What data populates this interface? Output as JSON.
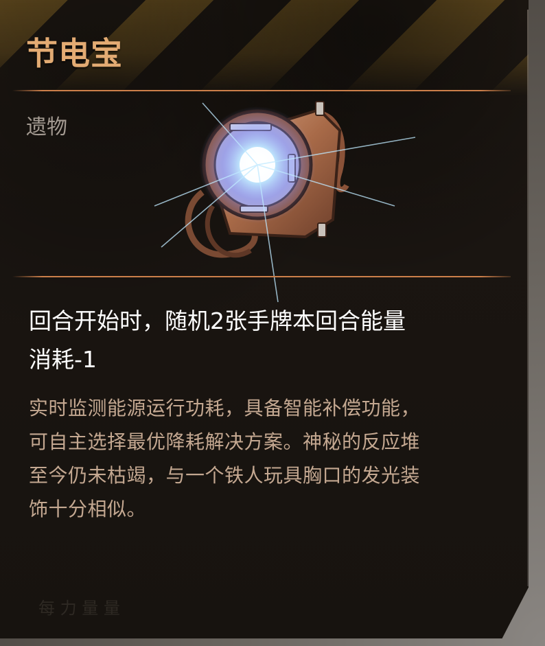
{
  "item": {
    "name": "节电宝",
    "category": "遗物",
    "effect_line1": "回合开始时，随机2张手牌本回合能量",
    "effect_line2": "消耗-1",
    "flavor_lines": [
      "实时监测能源运行功耗，具备智能补偿功能，",
      "可自主选择最优降耗解决方案。神秘的反应堆",
      "至今仍未枯竭，与一个铁人玩具胸口的发光装",
      "饰十分相似。"
    ],
    "faint_text": "每 力 量 量"
  },
  "colors": {
    "title": "#e3ab73",
    "divider": "#cc7f4a",
    "category": "#a39a91",
    "effect": "#ffffff",
    "flavor": "#c4a891",
    "card_bg": "#1a1511",
    "hazard_stripe": "#c49432",
    "artifact_copper": "#b7744f",
    "artifact_glow": "#bfe9ff"
  },
  "icons": {
    "artifact": "power-core-relic-icon"
  }
}
